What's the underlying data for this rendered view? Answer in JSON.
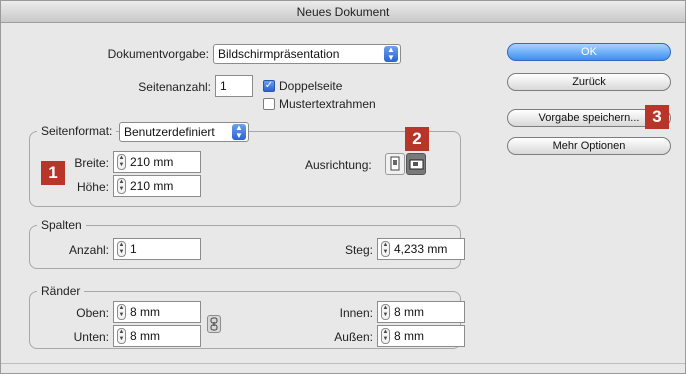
{
  "window": {
    "title": "Neues Dokument"
  },
  "document": {
    "preset_label": "Dokumentvorgabe:",
    "preset_value": "Bildschirmpräsentation",
    "pages_label": "Seitenanzahl:",
    "pages_value": "1",
    "facing_pages_label": "Doppelseite",
    "facing_pages_checked": true,
    "master_frame_label": "Mustertextrahmen",
    "master_frame_checked": false
  },
  "page_format": {
    "label": "Seitenformat:",
    "value": "Benutzerdefiniert",
    "width_label": "Breite:",
    "width_value": "210 mm",
    "height_label": "Höhe:",
    "height_value": "210 mm",
    "orientation_label": "Ausrichtung:"
  },
  "columns": {
    "title": "Spalten",
    "count_label": "Anzahl:",
    "count_value": "1",
    "gutter_label": "Steg:",
    "gutter_value": "4,233 mm"
  },
  "margins": {
    "title": "Ränder",
    "top_label": "Oben:",
    "top_value": "8 mm",
    "bottom_label": "Unten:",
    "bottom_value": "8 mm",
    "inside_label": "Innen:",
    "inside_value": "8 mm",
    "outside_label": "Außen:",
    "outside_value": "8 mm"
  },
  "buttons": {
    "ok": "OK",
    "back": "Zurück",
    "save_preset": "Vorgabe speichern...",
    "more_options": "Mehr Optionen"
  },
  "annotations": {
    "one": "1",
    "two": "2",
    "three": "3"
  },
  "colors": {
    "accent_blue": "#3d8ff0",
    "badge_red": "#b8352a"
  }
}
